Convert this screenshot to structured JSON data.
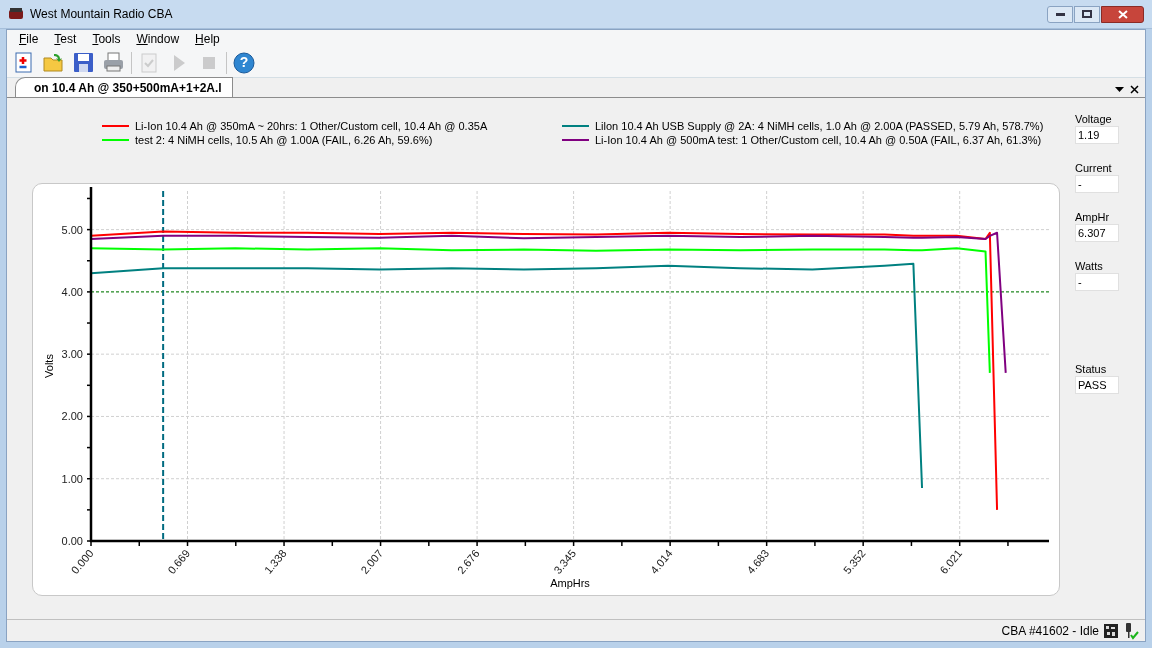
{
  "window": {
    "title": "West Mountain Radio CBA"
  },
  "menu": [
    {
      "label": "File"
    },
    {
      "label": "Test"
    },
    {
      "label": "Tools"
    },
    {
      "label": "Window"
    },
    {
      "label": "Help"
    }
  ],
  "toolbar": [
    {
      "kind": "new",
      "disabled": false
    },
    {
      "kind": "open",
      "disabled": false
    },
    {
      "kind": "save",
      "disabled": false
    },
    {
      "kind": "print",
      "disabled": false
    },
    {
      "kind": "sep"
    },
    {
      "kind": "check",
      "disabled": true
    },
    {
      "kind": "play",
      "disabled": true
    },
    {
      "kind": "stop",
      "disabled": true
    },
    {
      "kind": "sep"
    },
    {
      "kind": "help",
      "disabled": false,
      "glyph": "?"
    }
  ],
  "tabs": [
    {
      "label": "on 10.4 Ah @ 350+500mA+1+2A.l",
      "selected": true
    }
  ],
  "chart_data": {
    "type": "line",
    "xlabel": "AmpHrs",
    "ylabel": "Volts",
    "x": [
      0,
      0.5,
      1,
      1.5,
      2,
      2.5,
      3,
      3.5,
      4,
      4.5,
      5,
      5.5,
      5.7,
      5.76,
      6.0,
      6.2,
      6.23,
      6.28,
      6.34
    ],
    "series": [
      {
        "name": "Li-Ion 10.4 Ah @ 350mA ~ 20hrs: 1 Other/Custom cell, 10.4 Ah @ 0.35A",
        "color": "#ff0000",
        "values": [
          4.9,
          4.97,
          4.95,
          4.95,
          4.93,
          4.95,
          4.93,
          4.92,
          4.95,
          4.93,
          4.92,
          4.92,
          4.9,
          4.9,
          4.9,
          4.85,
          4.95,
          0.5,
          null
        ]
      },
      {
        "name": "test 2: 4 NiMH cells, 10.5 Ah @ 1.00A (FAIL, 6.26 Ah, 59.6%)",
        "color": "#00ff00",
        "values": [
          4.7,
          4.68,
          4.7,
          4.68,
          4.7,
          4.67,
          4.68,
          4.66,
          4.68,
          4.67,
          4.68,
          4.68,
          4.67,
          4.67,
          4.7,
          4.65,
          2.7,
          null,
          null
        ]
      },
      {
        "name": "Lilon 10.4 Ah USB Supply @ 2A: 4 NiMH cells, 1.0 Ah @ 2.00A (PASSED, 5.79 Ah, 578.7%)",
        "color": "#008080",
        "values": [
          4.3,
          4.38,
          4.38,
          4.38,
          4.36,
          4.38,
          4.36,
          4.38,
          4.42,
          4.38,
          4.36,
          4.42,
          4.45,
          0.85,
          null,
          null,
          null,
          null,
          null
        ]
      },
      {
        "name": "Li-Ion 10.4 Ah @ 500mA test: 1 Other/Custom cell, 10.4 Ah @ 0.50A (FAIL, 6.37 Ah, 61.3%)",
        "color": "#800080",
        "values": [
          4.85,
          4.9,
          4.9,
          4.88,
          4.87,
          4.9,
          4.86,
          4.88,
          4.9,
          4.88,
          4.9,
          4.88,
          4.87,
          4.87,
          4.88,
          4.85,
          4.9,
          4.95,
          2.7
        ]
      }
    ],
    "xlim": [
      0,
      6.64
    ],
    "ylim": [
      0,
      5.62
    ],
    "xticks": [
      {
        "value": 0,
        "label": "0.000"
      },
      {
        "value": 0.669,
        "label": "0.669"
      },
      {
        "value": 1.338,
        "label": "1.338"
      },
      {
        "value": 2.007,
        "label": "2.007"
      },
      {
        "value": 2.676,
        "label": "2.676"
      },
      {
        "value": 3.345,
        "label": "3.345"
      },
      {
        "value": 4.014,
        "label": "4.014"
      },
      {
        "value": 4.683,
        "label": "4.683"
      },
      {
        "value": 5.352,
        "label": "5.352"
      },
      {
        "value": 6.021,
        "label": "6.021"
      }
    ],
    "yticks": [
      {
        "value": 0,
        "label": "0.00"
      },
      {
        "value": 1,
        "label": "1.00"
      },
      {
        "value": 2,
        "label": "2.00"
      },
      {
        "value": 3,
        "label": "3.00"
      },
      {
        "value": 4,
        "label": "4.00"
      },
      {
        "value": 5,
        "label": "5.00"
      }
    ],
    "grid": true,
    "ref_lines": [
      {
        "axis": "y",
        "value": 4.0,
        "color": "#008000"
      },
      {
        "axis": "x",
        "value": 0.5,
        "color": "#006b80"
      }
    ]
  },
  "readouts": [
    {
      "label": "Voltage",
      "value": "1.19"
    },
    {
      "label": "Current",
      "value": "-"
    },
    {
      "label": "AmpHr",
      "value": "6.307"
    },
    {
      "label": "Watts",
      "value": "-"
    },
    {
      "label": "Status",
      "value": "PASS"
    }
  ],
  "status_bar": {
    "text": "CBA #41602 - Idle"
  }
}
